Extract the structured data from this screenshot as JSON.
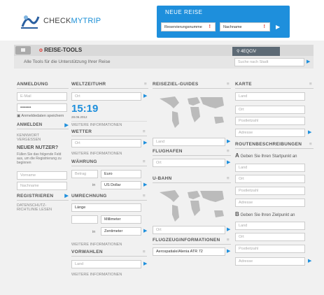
{
  "brand": {
    "check": "CHECK",
    "mytrip": "MYTRIP"
  },
  "neue_reise": {
    "title": "NEUE REISE",
    "reservation": "Reservierungsnumme",
    "name": "Nachname"
  },
  "tools": {
    "title": "REISE-TOOLS",
    "location": "4EQCIV",
    "subtitle": "Alle Tools für die Unterstützung Ihrer Reise",
    "search_placeholder": "Suche nach Stadt"
  },
  "anmeldung": {
    "title": "ANMELDUNG",
    "email": "E-Mail",
    "password": "••••••••",
    "remember": "Anmeldedaten speichern",
    "login": "ANMELDEN",
    "forgot": "KENNWORT VERGESSEN",
    "new_user": "NEUER NUTZER?",
    "new_user_text": "Füllen Sie das folgende Feld aus, um die Registrierung zu beginnen",
    "first": "Vorname",
    "last": "Nachname",
    "register": "REGISTRIEREN",
    "privacy": "DATENSCHUTZ-RICHTLINIE LESEN"
  },
  "weltzeituhr": {
    "title": "WELTZEITUHR",
    "placeholder": "Ort",
    "time": "15:19",
    "date": "28.06.2012",
    "more": "WEITERE INFORMATIONEN"
  },
  "wetter": {
    "title": "WETTER",
    "placeholder": "Ort",
    "more": "WEITERE INFORMATIONEN"
  },
  "waehrung": {
    "title": "WÄHRUNG",
    "amount": "Betrag",
    "from": "Euro",
    "in": "in",
    "to": "US Dollar"
  },
  "umrechnung": {
    "title": "UMRECHNUNG",
    "kind": "Länge",
    "from": "Millimeter",
    "in": "in",
    "to": "Zentimeter",
    "more": "WEITERE INFORMATIONEN"
  },
  "vorwahlen": {
    "title": "VORWAHLEN",
    "placeholder": "Land",
    "more": "WEITERE INFORMATIONEN"
  },
  "guides": {
    "title": "REISEZIEL-GUIDES",
    "placeholder": "Land"
  },
  "flughafen": {
    "title": "FLUGHAFEN",
    "placeholder": "Ort"
  },
  "ubahn": {
    "title": "U-BAHN",
    "placeholder": "Ort"
  },
  "flugzeug": {
    "title": "FLUGZEUGINFORMATIONEN",
    "value": "Aerospatiale/Alenia ATR 72"
  },
  "karte": {
    "title": "KARTE",
    "land": "Land",
    "ort": "Ort",
    "plz": "Postleitzahl",
    "adresse": "Adresse"
  },
  "routen": {
    "title": "ROUTENBESCHREIBUNGEN",
    "a_label": "A",
    "a_text": "Geben Sie Ihren Startpunkt an",
    "b_label": "B",
    "b_text": "Geben Sie Ihren Zielpunkt an",
    "land": "Land",
    "ort": "Ort",
    "plz": "Postleitzahl",
    "adresse": "Adresse"
  },
  "colors": {
    "accent": "#1e8fdc",
    "alert": "#e0302a"
  }
}
